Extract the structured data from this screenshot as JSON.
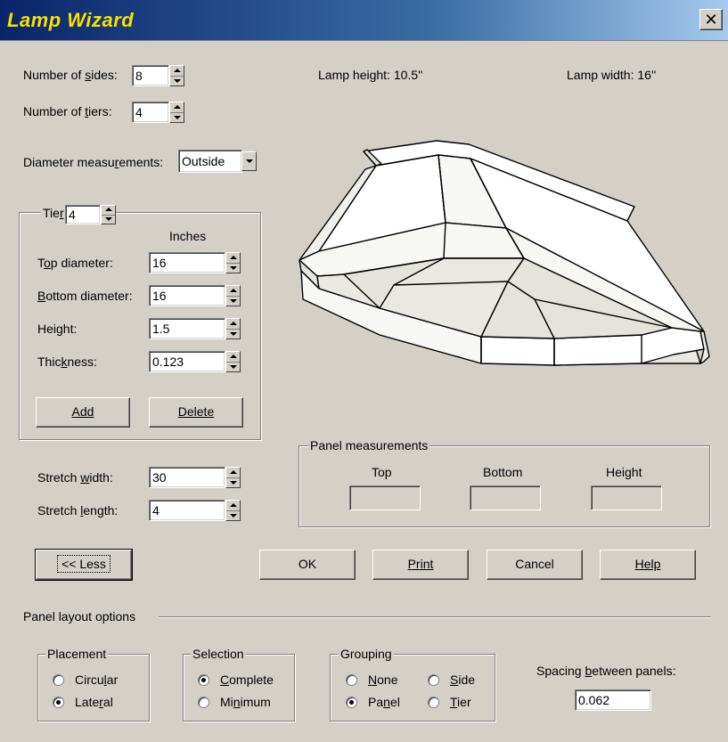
{
  "window": {
    "title": "Lamp Wizard",
    "close_label": "✕"
  },
  "top": {
    "sides": {
      "pre": "Number of ",
      "key": "s",
      "post": "ides:",
      "value": "8"
    },
    "tiers": {
      "pre": "Number of ",
      "key": "t",
      "post": "iers:",
      "value": "4"
    },
    "lamp_height": "Lamp height: 10.5''",
    "lamp_width": "Lamp width: 16''",
    "diameter": {
      "pre": "Diameter measu",
      "key": "r",
      "post": "ements:",
      "value": "Outside"
    }
  },
  "tier_group": {
    "title_pre": "Tie",
    "title_key": "r",
    "value": "4",
    "inches_label": "Inches",
    "fields": [
      {
        "pre": "T",
        "key": "o",
        "post": "p diameter:",
        "value": "16"
      },
      {
        "pre": "",
        "key": "B",
        "post": "ottom diameter:",
        "value": "16"
      },
      {
        "pre": "",
        "key": "",
        "post": "Height:",
        "value": "1.5"
      },
      {
        "pre": "Thic",
        "key": "k",
        "post": "ness:",
        "value": "0.123"
      }
    ],
    "add_label": "Add",
    "delete_label": "Delete"
  },
  "stretch": {
    "width": {
      "pre": "Stretch ",
      "key": "w",
      "post": "idth:",
      "value": "30"
    },
    "length": {
      "pre": "Stretch ",
      "key": "l",
      "post": "ength:",
      "value": "4"
    }
  },
  "panel_measurements": {
    "title": "Panel measurements",
    "columns": [
      "Top",
      "Bottom",
      "Height"
    ],
    "values": [
      "",
      "",
      ""
    ]
  },
  "buttons": {
    "less": "<< Less",
    "ok": "OK",
    "print": "Print",
    "cancel": "Cancel",
    "help": "Help"
  },
  "layout_options": {
    "title": "Panel layout options",
    "placement": {
      "title": "Placement",
      "options": [
        {
          "pre": "Circu",
          "key": "l",
          "post": "ar",
          "selected": false
        },
        {
          "pre": "Late",
          "key": "r",
          "post": "al",
          "selected": true
        }
      ]
    },
    "selection": {
      "title": "Selection",
      "options": [
        {
          "pre": "",
          "key": "C",
          "post": "omplete",
          "selected": true
        },
        {
          "pre": "Mi",
          "key": "n",
          "post": "imum",
          "selected": false
        }
      ]
    },
    "grouping": {
      "title": "Grouping",
      "options": [
        {
          "pre": "",
          "key": "N",
          "post": "one",
          "selected": false
        },
        {
          "pre": "",
          "key": "S",
          "post": "ide",
          "selected": false
        },
        {
          "pre": "Pa",
          "key": "n",
          "post": "el",
          "selected": true
        },
        {
          "pre": "",
          "key": "T",
          "post": "ier",
          "selected": false
        }
      ]
    },
    "spacing": {
      "pre": "Spacing ",
      "key": "b",
      "post": "etween panels:",
      "value": "0.062"
    }
  },
  "colors": {
    "face": "#d4d0c8",
    "title_text": "#f7e000",
    "title_bar": "#0a246a"
  }
}
